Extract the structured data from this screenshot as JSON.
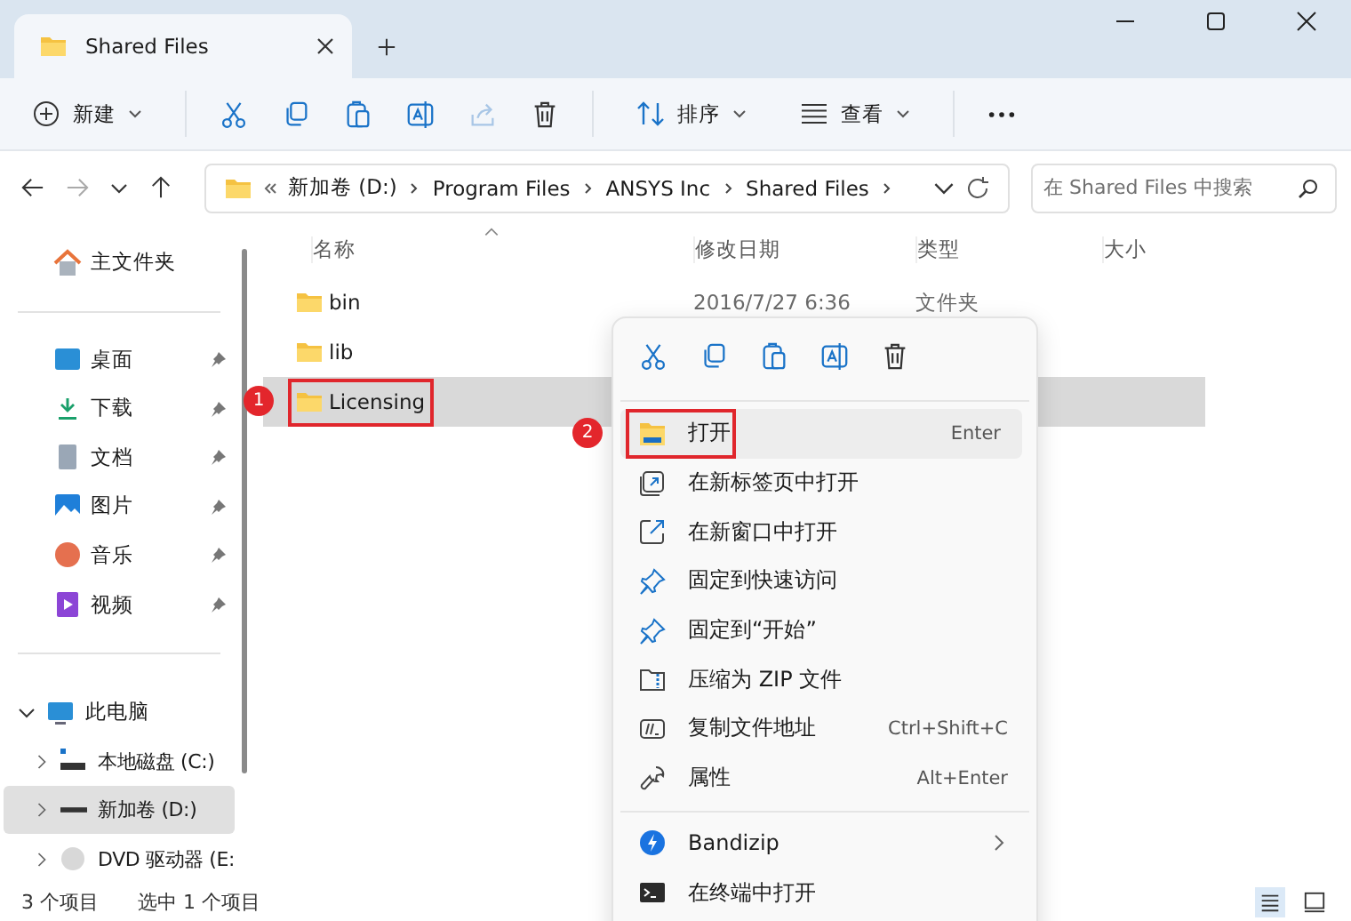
{
  "window": {
    "tab_title": "Shared Files"
  },
  "toolbar": {
    "new_label": "新建",
    "actions": [
      {
        "kind": "cut",
        "disabled": false
      },
      {
        "kind": "copy",
        "disabled": false
      },
      {
        "kind": "paste",
        "disabled": false
      },
      {
        "kind": "rename",
        "disabled": false
      },
      {
        "kind": "share",
        "disabled": true
      },
      {
        "kind": "delete",
        "disabled": false
      }
    ],
    "sort_label": "排序",
    "view_label": "查看"
  },
  "address": {
    "crumbs": [
      "新加卷 (D:)",
      "Program Files",
      "ANSYS Inc",
      "Shared Files"
    ],
    "search": {
      "placeholder": "在 Shared Files 中搜索"
    }
  },
  "sidebar": {
    "home": "主文件夹",
    "quick": [
      {
        "label": "桌面",
        "kind": "desktop",
        "pinned": true
      },
      {
        "label": "下载",
        "kind": "download",
        "pinned": true
      },
      {
        "label": "文档",
        "kind": "documents",
        "pinned": true
      },
      {
        "label": "图片",
        "kind": "pictures",
        "pinned": true
      },
      {
        "label": "音乐",
        "kind": "music",
        "pinned": true
      },
      {
        "label": "视频",
        "kind": "videos",
        "pinned": true
      }
    ],
    "this_pc": {
      "label": "此电脑",
      "expanded": true,
      "children": [
        {
          "label": "本地磁盘 (C:)",
          "kind": "system-drive",
          "selected": false
        },
        {
          "label": "新加卷 (D:)",
          "kind": "drive",
          "selected": true
        },
        {
          "label": "DVD 驱动器 (E:",
          "kind": "dvd",
          "selected": false
        }
      ]
    }
  },
  "columns": [
    "名称",
    "修改日期",
    "类型",
    "大小"
  ],
  "rows": [
    {
      "name": "bin",
      "date": "2016/7/27 6:36",
      "type": "文件夹",
      "selected": false
    },
    {
      "name": "lib",
      "selected": false
    },
    {
      "name": "Licensing",
      "selected": true,
      "callout": "1"
    }
  ],
  "context_menu": {
    "actions": [
      {
        "kind": "cut"
      },
      {
        "kind": "copy"
      },
      {
        "kind": "paste"
      },
      {
        "kind": "rename"
      },
      {
        "kind": "delete"
      }
    ],
    "sections": [
      [
        {
          "label": "打开",
          "kind": "open",
          "shortcut": "Enter",
          "highlighted": true,
          "callout": "2"
        },
        {
          "label": "在新标签页中打开",
          "kind": "new-tab",
          "highlighted": false
        },
        {
          "label": "在新窗口中打开",
          "kind": "new-window",
          "highlighted": false
        },
        {
          "label": "固定到快速访问",
          "kind": "pin",
          "highlighted": false
        },
        {
          "label": "固定到“开始”",
          "kind": "pin",
          "highlighted": false
        },
        {
          "label": "压缩为 ZIP 文件",
          "kind": "zip",
          "highlighted": false
        },
        {
          "label": "复制文件地址",
          "kind": "copy-path",
          "shortcut": "Ctrl+Shift+C",
          "highlighted": false
        },
        {
          "label": "属性",
          "kind": "properties",
          "shortcut": "Alt+Enter",
          "highlighted": false
        }
      ],
      [
        {
          "label": "Bandizip",
          "kind": "bandizip",
          "submenu": true,
          "highlighted": false
        },
        {
          "label": "在终端中打开",
          "kind": "terminal",
          "highlighted": false
        }
      ]
    ]
  },
  "status_bar": [
    "3 个项目",
    "选中 1 个项目"
  ]
}
